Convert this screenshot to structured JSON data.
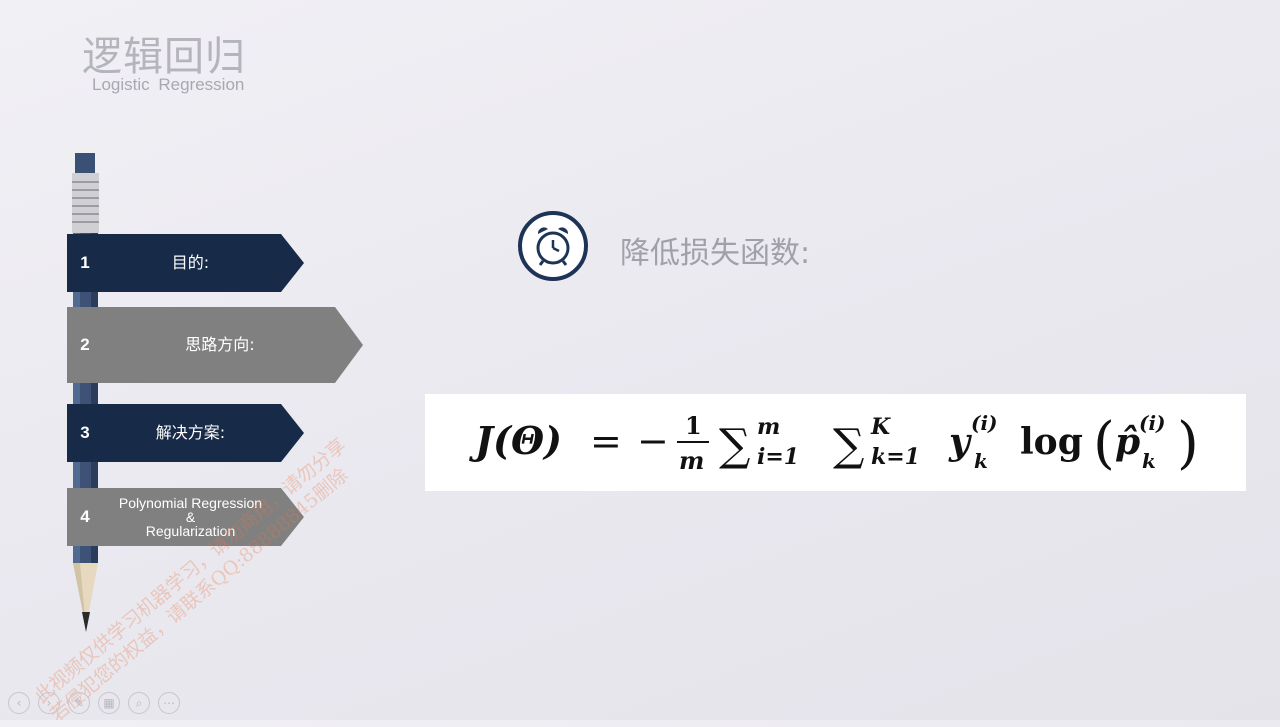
{
  "header": {
    "title_zh": "逻辑回归",
    "title_en": "Logistic  Regression"
  },
  "menu": {
    "items": [
      {
        "num": "1",
        "label": "目的:"
      },
      {
        "num": "2",
        "label": "思路方向:"
      },
      {
        "num": "3",
        "label": "解决方案:"
      },
      {
        "num": "4",
        "label_lines": [
          "Polynomial Regression",
          "&",
          "Regularization"
        ]
      }
    ]
  },
  "content": {
    "icon": "alarm-clock-icon",
    "heading": "降低损失函数:",
    "formula": {
      "lhs": "J(Θ)",
      "equals": "=",
      "sign": "−",
      "frac_num": "1",
      "frac_den": "m",
      "sum1_sup": "m",
      "sum1_sub": "i=1",
      "sum2_sup": "K",
      "sum2_sub": "k=1",
      "y": "y",
      "y_sup": "(i)",
      "y_sub": "k",
      "log": "log",
      "p": "p̂",
      "p_sup": "(i)",
      "p_sub": "k"
    }
  },
  "watermark": {
    "lines": [
      "此视频仅供学习机器学习，请勿商用，请勿分享",
      "若侵犯您的权益，请联系QQ:88888845删除"
    ]
  },
  "toolbar": {
    "icons": [
      "prev-icon",
      "next-icon",
      "pen-icon",
      "slides-icon",
      "zoom-icon",
      "more-icon"
    ]
  },
  "colors": {
    "navy": "#172a47",
    "gray_arrow": "#808080",
    "clock": "#1e3457",
    "title_gray": "#b4b4bc"
  }
}
